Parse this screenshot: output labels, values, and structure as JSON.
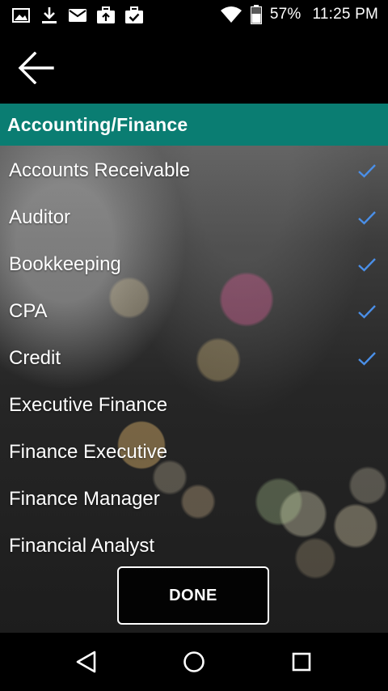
{
  "status_bar": {
    "left_icons": [
      "image-icon",
      "download-icon",
      "mail-icon",
      "briefcase-upload-icon",
      "briefcase-check-icon"
    ],
    "battery": "57%",
    "time": "11:25 PM"
  },
  "toolbar": {
    "back_icon": "arrow-left-icon"
  },
  "section": {
    "title": "Accounting/Finance",
    "color": "#0a7d72"
  },
  "items": [
    {
      "label": "Accounts Receivable",
      "checked": true
    },
    {
      "label": "Auditor",
      "checked": true
    },
    {
      "label": "Bookkeeping",
      "checked": true
    },
    {
      "label": "CPA",
      "checked": true
    },
    {
      "label": "Credit",
      "checked": true
    },
    {
      "label": "Executive Finance",
      "checked": false
    },
    {
      "label": "Finance Executive",
      "checked": false
    },
    {
      "label": "Finance Manager",
      "checked": false
    },
    {
      "label": "Financial Analyst",
      "checked": false
    }
  ],
  "check_color": "#4a8fe8",
  "done_label": "DONE",
  "nav": {
    "icons": [
      "back-triangle-icon",
      "home-circle-icon",
      "recents-square-icon"
    ]
  }
}
